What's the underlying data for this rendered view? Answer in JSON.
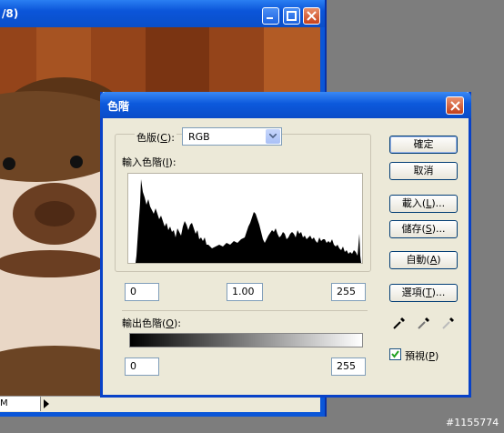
{
  "background_window": {
    "title_fragment": "/8)",
    "zoom": "M"
  },
  "dialog": {
    "title": "色階",
    "channel": {
      "label": "色版(C):",
      "label_pre": "色版(",
      "mnemonic": "C",
      "label_post": "):",
      "value": "RGB"
    },
    "input_levels": {
      "label_pre": "輸入色階(",
      "mnemonic": "I",
      "label_post": "):",
      "black": "0",
      "gamma": "1.00",
      "white": "255"
    },
    "output_levels": {
      "label_pre": "輸出色階(",
      "mnemonic": "O",
      "label_post": "):",
      "black": "0",
      "white": "255"
    },
    "buttons": {
      "ok": "確定",
      "cancel": "取消",
      "load_pre": "載入(",
      "load_m": "L",
      "load_post": ")...",
      "save_pre": "儲存(",
      "save_m": "S",
      "save_post": ")...",
      "auto_pre": "自動(",
      "auto_m": "A",
      "auto_post": ")",
      "options_pre": "選項(",
      "options_m": "T",
      "options_post": ")..."
    },
    "preview": {
      "label_pre": "預視(",
      "mnemonic": "P",
      "label_post": ")",
      "checked": true
    },
    "eyedroppers": [
      "black-eyedropper-icon",
      "gray-eyedropper-icon",
      "white-eyedropper-icon"
    ]
  },
  "watermark": "#1155774",
  "colors": {
    "titlebar": "#0a4fc9",
    "dialog_bg": "#ece9d8",
    "close": "#c8421b"
  }
}
